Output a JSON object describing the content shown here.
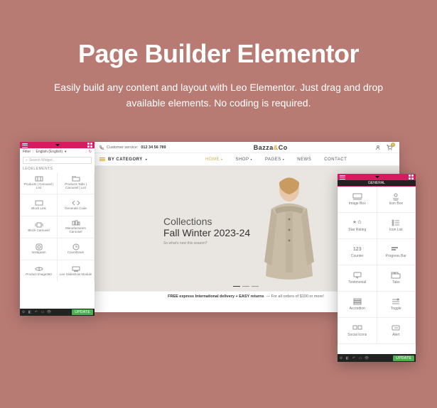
{
  "hero": {
    "title": "Page Builder Elementor",
    "subtitle": "Easily build any content and layout with Leo Elementor. Just drag and drop available elements. No coding is required."
  },
  "left_panel": {
    "filter_label": "Filter",
    "lang": "English (English)",
    "search_placeholder": "Search Widget...",
    "section_label": "LEOELEMENTS",
    "widgets": [
      {
        "label": "Products | Carousel | List"
      },
      {
        "label": "Products Tabs | Carousel | List"
      },
      {
        "label": "Block Link"
      },
      {
        "label": "Generate Code"
      },
      {
        "label": "Block Carousel"
      },
      {
        "label": "Manufacturers Carousel"
      },
      {
        "label": "Instagram"
      },
      {
        "label": "CountDown"
      },
      {
        "label": "Product Image360"
      },
      {
        "label": "Leo Slideshow Module"
      }
    ],
    "update_label": "UPDATE"
  },
  "site": {
    "customer_service_label": "Customer service:",
    "phone": "012 34 56 789",
    "brand_main": "Bazza",
    "brand_amp": "&",
    "brand_co": "Co",
    "cart_count": "0",
    "nav_category": "BY CATEGORY",
    "nav_items": [
      {
        "label": "HOME",
        "active": true,
        "caret": true
      },
      {
        "label": "SHOP",
        "active": false,
        "caret": true
      },
      {
        "label": "PAGES",
        "active": false,
        "caret": true
      },
      {
        "label": "NEWS",
        "active": false,
        "caret": false
      },
      {
        "label": "CONTACT",
        "active": false,
        "caret": false
      }
    ],
    "hero_line1": "Collections",
    "hero_line2": "Fall Winter 2023-24",
    "hero_line3": "So what's new this season?",
    "promo_strong": "FREE express International delivery + EASY returns",
    "promo_rest": "— For all orders of $100 or more!"
  },
  "right_panel": {
    "tab_label": "GENERAL",
    "widgets": [
      {
        "label": "Image Box"
      },
      {
        "label": "Icon Box"
      },
      {
        "label": "Star Rating"
      },
      {
        "label": "Icon List"
      },
      {
        "label": "Counter"
      },
      {
        "label": "Progress Bar"
      },
      {
        "label": "Testimonial"
      },
      {
        "label": "Tabs"
      },
      {
        "label": "Accordion"
      },
      {
        "label": "Toggle"
      },
      {
        "label": "Social Icons"
      },
      {
        "label": "Alert"
      }
    ],
    "update_label": "UPDATE"
  }
}
